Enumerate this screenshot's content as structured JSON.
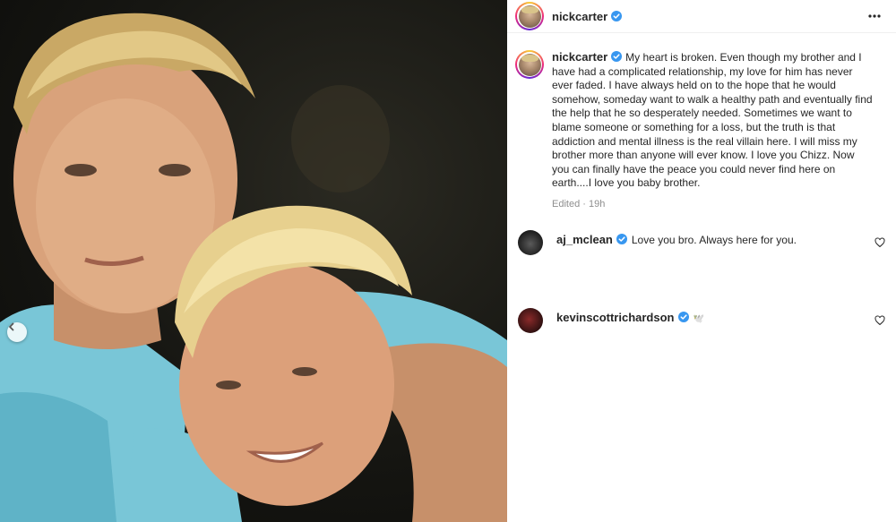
{
  "post": {
    "author": "nickcarter",
    "caption": "My heart is broken. Even though my brother and I have had a complicated relationship, my love for him has never ever faded. I have always held on to the hope that he would somehow, someday want to walk a healthy path and eventually find the help that he so desperately needed. Sometimes we want to blame someone or something for a loss, but the truth is that addiction and mental illness is the real villain here. I will miss my brother more than anyone will ever know. I love you Chizz. Now you can finally have the peace you could never find here on earth....I love you baby brother.",
    "meta": "Edited · 19h"
  },
  "comments": [
    {
      "author": "aj_mclean",
      "text": "Love you bro. Always here for you."
    },
    {
      "author": "kevinscottrichardson",
      "text": "🕊️"
    }
  ],
  "icons": {
    "verified": "verified-badge-icon",
    "more": "more-options-icon",
    "heart": "heart-outline-icon",
    "prev": "chevron-left-icon"
  },
  "colors": {
    "verified": "#3897f0",
    "text": "#262626",
    "muted": "#8e8e8e"
  }
}
